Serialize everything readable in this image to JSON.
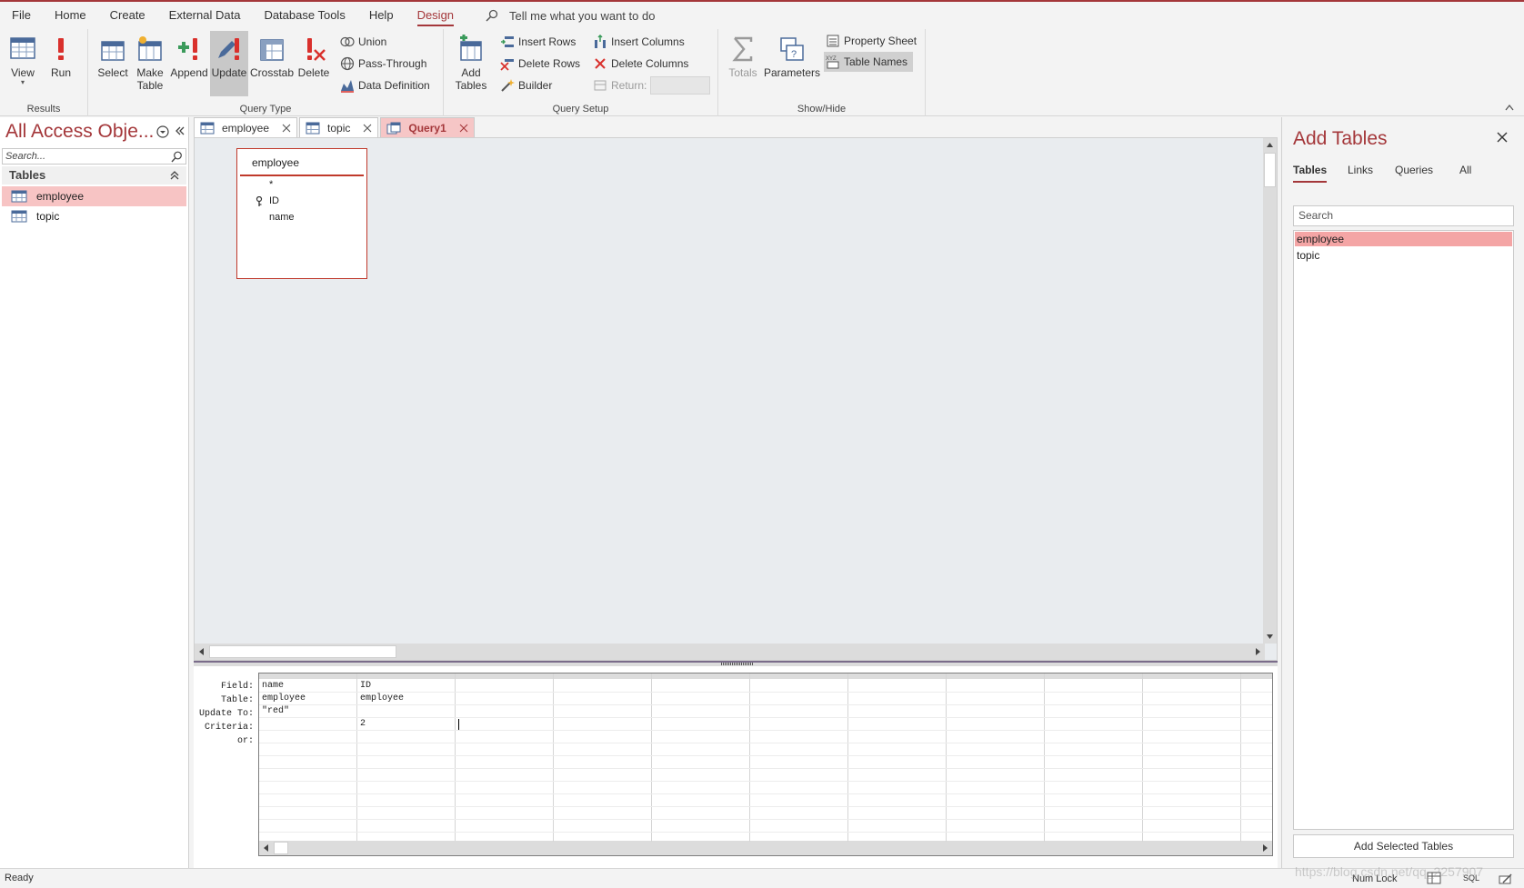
{
  "menu": {
    "items": [
      "File",
      "Home",
      "Create",
      "External Data",
      "Database Tools",
      "Help",
      "Design"
    ],
    "active": "Design",
    "tell_me": "Tell me what you want to do"
  },
  "ribbon": {
    "results": {
      "label": "Results",
      "view": "View",
      "run": "Run"
    },
    "query_type": {
      "label": "Query Type",
      "select": "Select",
      "make_table_line1": "Make",
      "make_table_line2": "Table",
      "append": "Append",
      "update": "Update",
      "crosstab": "Crosstab",
      "delete": "Delete",
      "union": "Union",
      "pass_through": "Pass-Through",
      "data_definition": "Data Definition"
    },
    "query_setup": {
      "label": "Query Setup",
      "add_tables_line1": "Add",
      "add_tables_line2": "Tables",
      "insert_rows": "Insert Rows",
      "delete_rows": "Delete Rows",
      "builder": "Builder",
      "insert_columns": "Insert Columns",
      "delete_columns": "Delete Columns",
      "return": "Return:"
    },
    "show_hide": {
      "label": "Show/Hide",
      "totals": "Totals",
      "parameters": "Parameters",
      "property_sheet": "Property Sheet",
      "table_names": "Table Names"
    }
  },
  "nav": {
    "title": "All Access Obje...",
    "search_placeholder": "Search...",
    "section": "Tables",
    "items": [
      "employee",
      "topic"
    ],
    "selected": "employee"
  },
  "doc_tabs": [
    {
      "label": "employee",
      "kind": "table"
    },
    {
      "label": "topic",
      "kind": "table"
    },
    {
      "label": "Query1",
      "kind": "query"
    }
  ],
  "field_list": {
    "title": "employee",
    "fields": [
      "*",
      "ID",
      "name"
    ]
  },
  "grid": {
    "row_labels": [
      "Field:",
      "Table:",
      "Update To:",
      "Criteria:",
      "or:"
    ],
    "columns": [
      {
        "field": "name",
        "table": "employee",
        "update_to": "\"red\"",
        "criteria": "",
        "or": ""
      },
      {
        "field": "ID",
        "table": "employee",
        "update_to": "",
        "criteria": "2",
        "or": ""
      }
    ]
  },
  "add_tables": {
    "title": "Add Tables",
    "tabs": [
      "Tables",
      "Links",
      "Queries",
      "All"
    ],
    "active_tab": "Tables",
    "search_placeholder": "Search",
    "items": [
      "employee",
      "topic"
    ],
    "selected": "employee",
    "add_button": "Add Selected Tables"
  },
  "status": {
    "text": "Ready",
    "num_lock": "Num Lock",
    "sql_label": "SQL"
  },
  "watermark": "https://blog.csdn.net/qq_2257907",
  "colors": {
    "accent": "#a4373a",
    "selection": "#f7c4c4"
  }
}
